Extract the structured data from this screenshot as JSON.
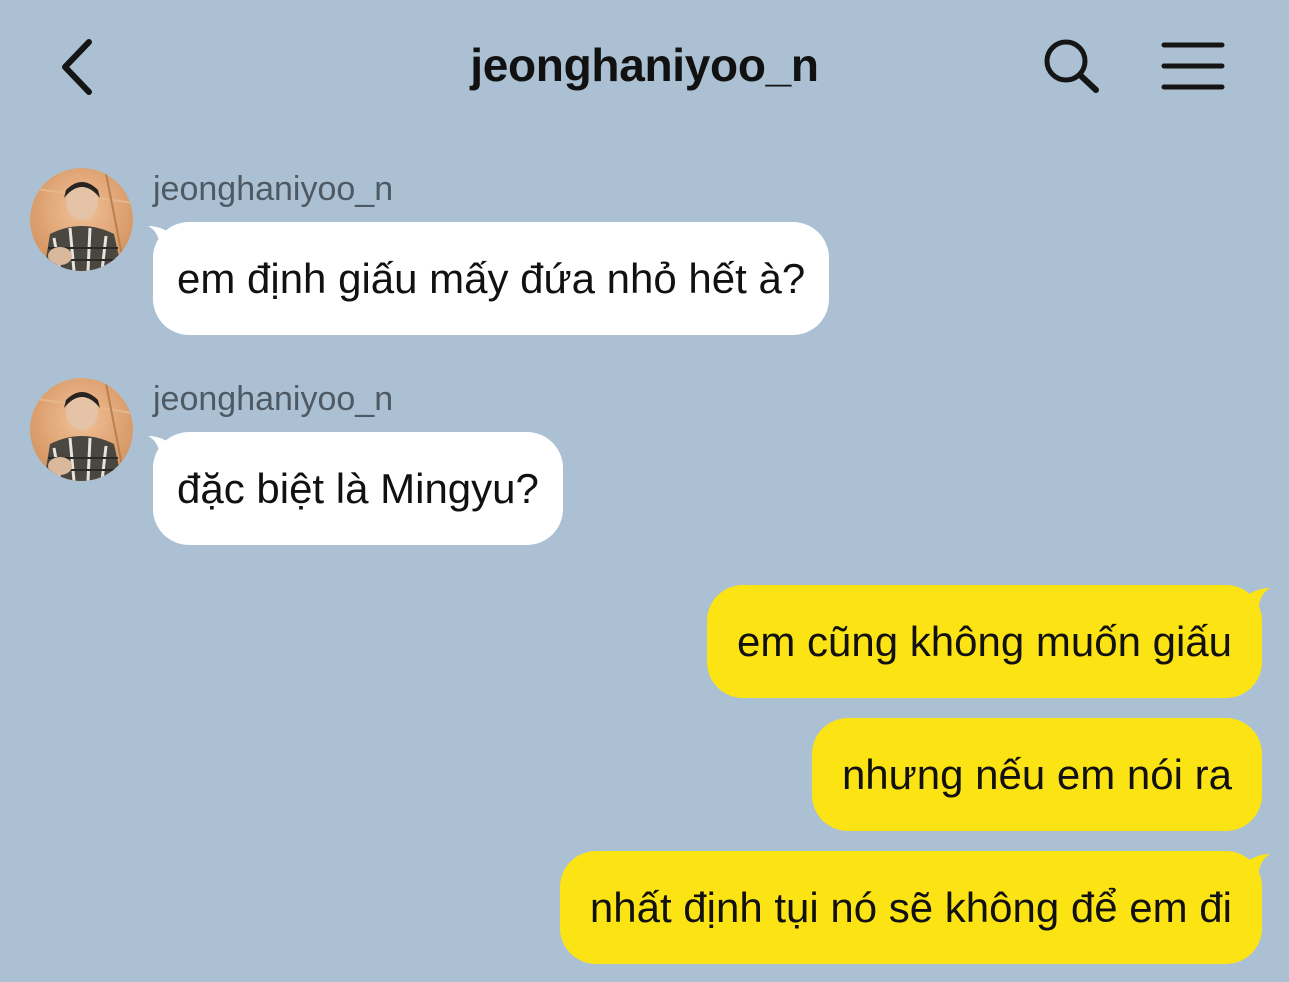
{
  "header": {
    "title": "jeonghaniyoo_n",
    "back_icon": "chevron-left-icon",
    "search_icon": "search-icon",
    "menu_icon": "hamburger-menu-icon"
  },
  "colors": {
    "background": "#abc1d3",
    "incoming_bubble": "#ffffff",
    "outgoing_bubble": "#fce313",
    "sender_name": "#4f5963"
  },
  "messages": [
    {
      "direction": "incoming",
      "sender": "jeonghaniyoo_n",
      "text": "em định giấu mấy đứa nhỏ hết à?"
    },
    {
      "direction": "incoming",
      "sender": "jeonghaniyoo_n",
      "text": "đặc biệt là Mingyu?"
    },
    {
      "direction": "outgoing",
      "text": "em cũng không muốn giấu"
    },
    {
      "direction": "outgoing",
      "text": "nhưng nếu em nói ra"
    },
    {
      "direction": "outgoing",
      "text": "nhất định tụi nó sẽ không để em đi"
    }
  ]
}
